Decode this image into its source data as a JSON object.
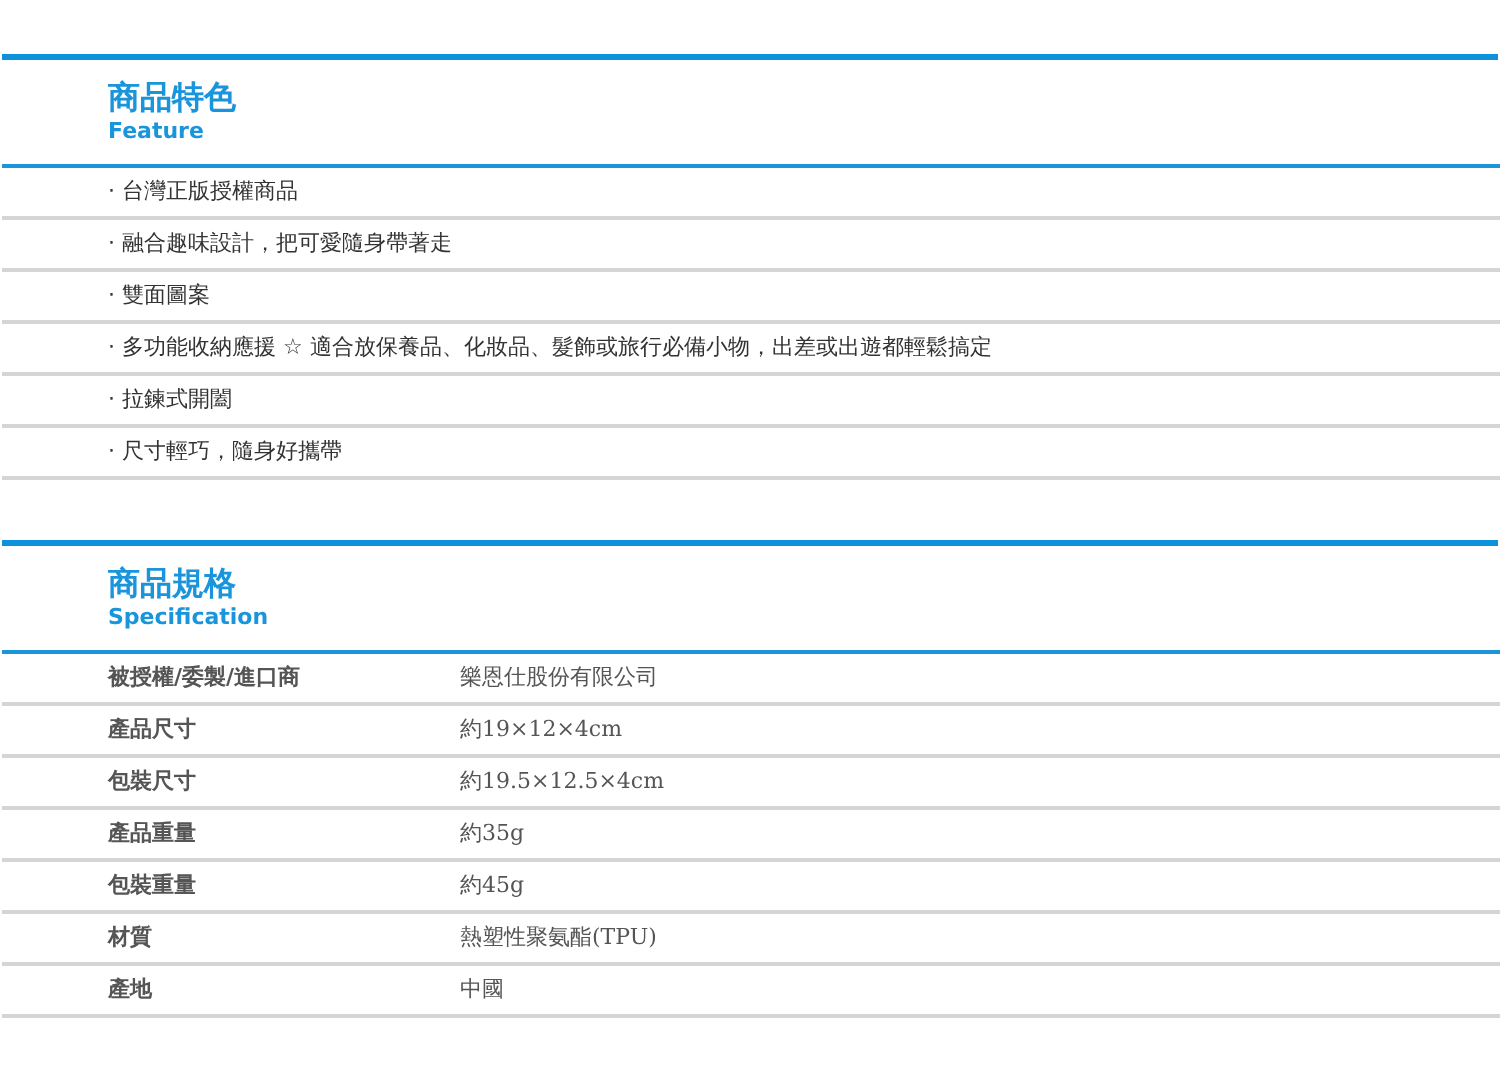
{
  "sections": [
    {
      "title": "商品特色",
      "subtitle": "Feature",
      "kind": "list",
      "items": [
        "· 台灣正版授權商品",
        "· 融合趣味設計，把可愛隨身帶著走",
        "· 雙面圖案",
        "· 多功能收納應援 ☆ 適合放保養品、化妝品、髮飾或旅行必備小物，出差或出遊都輕鬆搞定",
        "· 拉鍊式開闔",
        "· 尺寸輕巧，隨身好攜帶"
      ]
    },
    {
      "title": "商品規格",
      "subtitle": "Specification",
      "kind": "table",
      "rows": [
        {
          "label": "被授權/委製/進口商",
          "value": "樂恩仕股份有限公司"
        },
        {
          "label": "產品尺寸",
          "value": "約19×12×4cm"
        },
        {
          "label": "包裝尺寸",
          "value": "約19.5×12.5×4cm"
        },
        {
          "label": "產品重量",
          "value": "約35g"
        },
        {
          "label": "包裝重量",
          "value": "約45g"
        },
        {
          "label": "材質",
          "value": "熱塑性聚氨酯(TPU)"
        },
        {
          "label": "產地",
          "value": "中國"
        }
      ]
    }
  ]
}
